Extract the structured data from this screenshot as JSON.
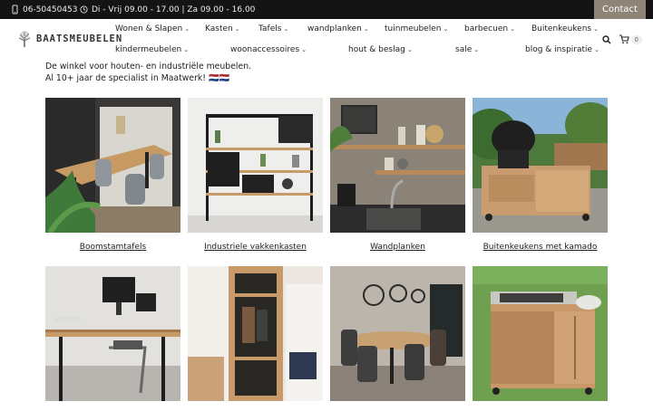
{
  "topbar": {
    "phone": "06-50450453",
    "hours": "Di - Vrij 09.00 - 17.00 | Za 09.00 - 16.00",
    "contact_label": "Contact"
  },
  "logo": {
    "text": "BAATSMEUBELEN"
  },
  "nav": {
    "row1": [
      "Wonen & Slapen",
      "Kasten",
      "Tafels",
      "wandplanken",
      "tuinmeubelen",
      "barbecuen",
      "Buitenkeukens"
    ],
    "row2": [
      "kindermeubelen",
      "woonaccessoires",
      "hout & beslag",
      "sale",
      "blog & inspiratie"
    ]
  },
  "cart": {
    "count": "0"
  },
  "intro": {
    "line1": "De winkel voor houten- en industriële meubelen.",
    "line2": "Al 10+ jaar de specialist in Maatwerk! 🇳🇱🇳🇱"
  },
  "categories": [
    {
      "label": "Boomstamtafels"
    },
    {
      "label": "Industriele vakkenkasten"
    },
    {
      "label": "Wandplanken"
    },
    {
      "label": "Buitenkeukens met kamado"
    },
    {
      "label": ""
    },
    {
      "label": ""
    },
    {
      "label": ""
    },
    {
      "label": ""
    }
  ],
  "colors": {
    "topbar": "#141414",
    "contact": "#8f8478",
    "text": "#222222"
  },
  "icons": [
    "phone-icon",
    "clock-icon",
    "search-icon",
    "cart-icon"
  ]
}
